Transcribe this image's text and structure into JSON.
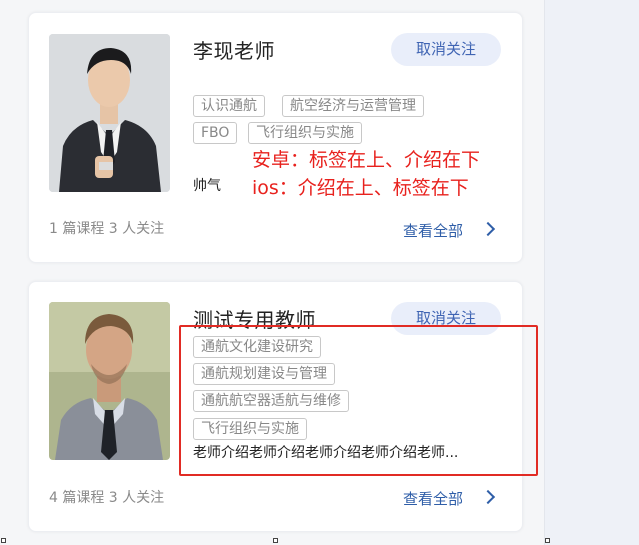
{
  "teachers": [
    {
      "name": "李现老师",
      "unfollow_label": "取消关注",
      "tags": [
        "认识通航",
        "航空经济与运营管理",
        "FBO",
        "飞行组织与实施"
      ],
      "bio": "帅气",
      "stats": "1 篇课程  3 人关注",
      "view_all": "查看全部"
    },
    {
      "name": "测试专用教师",
      "unfollow_label": "取消关注",
      "tags": [
        "通航文化建设研究",
        "通航规划建设与管理",
        "通航航空器适航与维修",
        "飞行组织与实施"
      ],
      "bio": "老师介绍老师介绍老师介绍老师介绍老师...",
      "stats": "4 篇课程  3 人关注",
      "view_all": "查看全部"
    }
  ],
  "annotation": {
    "line1": "安卓：标签在上、介绍在下",
    "line2": "ios：介绍在上、标签在下"
  },
  "icons": {
    "chevron": "chevron-right-icon"
  },
  "colors": {
    "accent": "#2f5ea8",
    "button_bg": "#e9eefa",
    "annotation_red": "#e8211d"
  }
}
